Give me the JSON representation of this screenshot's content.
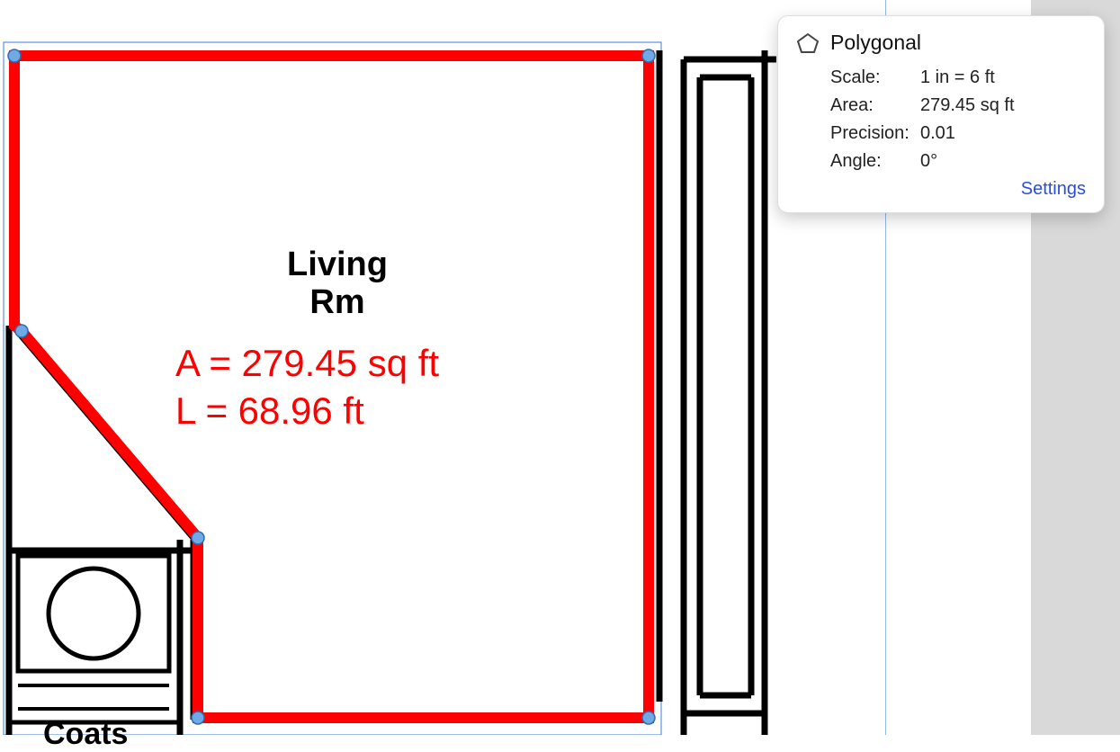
{
  "canvas": {
    "room_label_line1": "Living",
    "room_label_line2": "Rm",
    "measure_area": "A = 279.45 sq ft",
    "measure_length": "L = 68.96 ft",
    "coats_label": "Coats"
  },
  "panel": {
    "title": "Polygonal",
    "rows": {
      "scale_label": "Scale:",
      "scale_value": "1 in = 6 ft",
      "area_label": "Area:",
      "area_value": "279.45 sq ft",
      "precision_label": "Precision:",
      "precision_value": "0.01",
      "angle_label": "Angle:",
      "angle_value": "0°"
    },
    "settings_label": "Settings"
  }
}
